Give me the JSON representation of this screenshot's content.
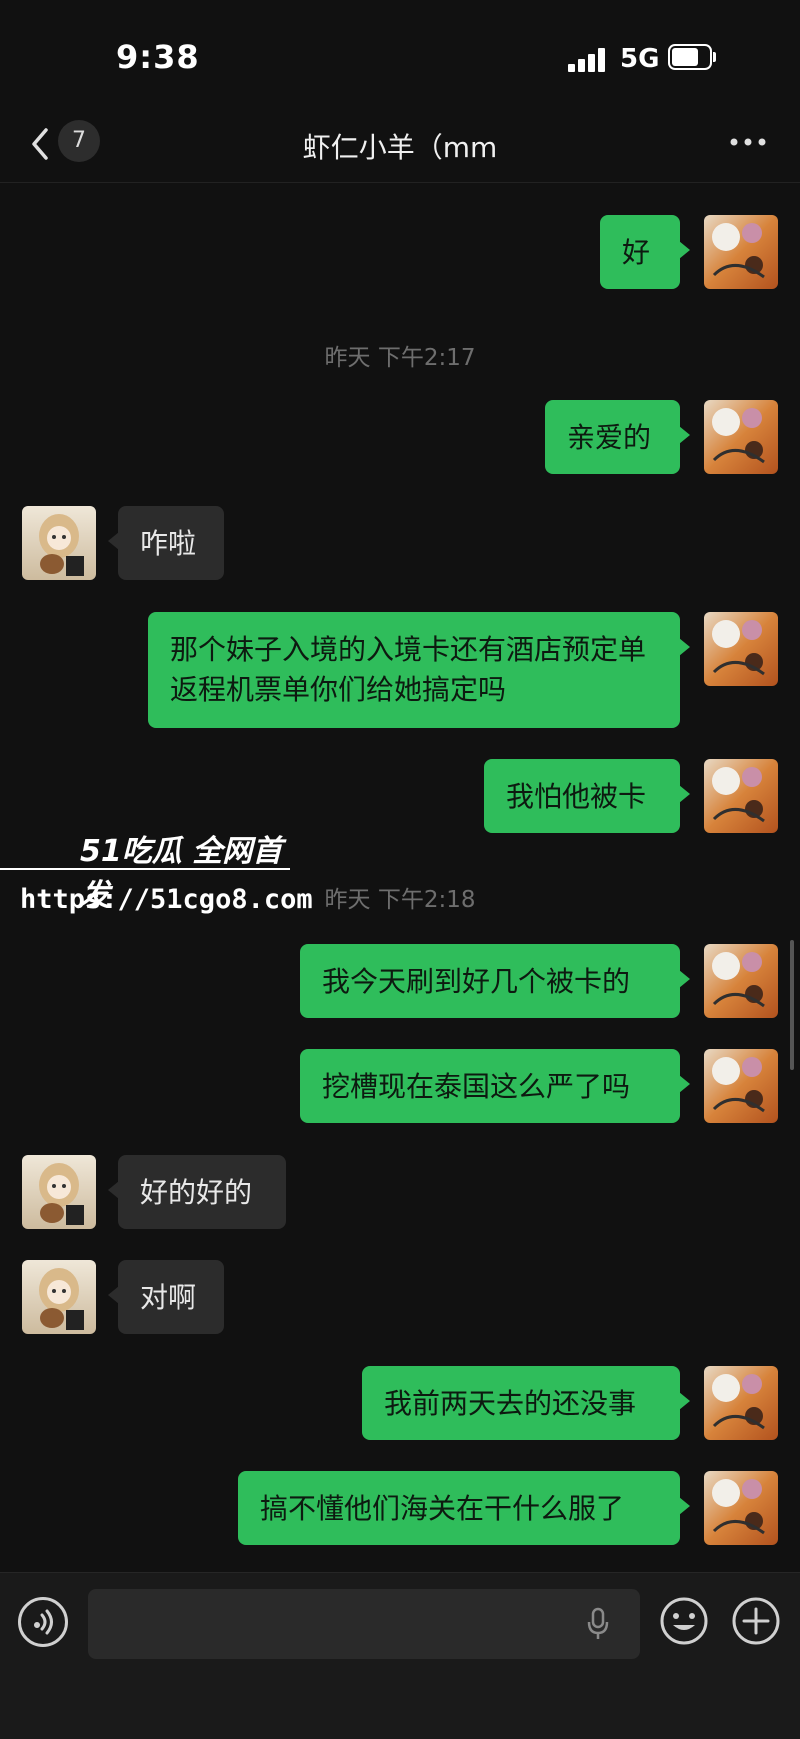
{
  "status": {
    "time": "9:38",
    "network": "5G"
  },
  "header": {
    "unread_count": "7",
    "title": "虾仁小羊（mm"
  },
  "timestamps": [
    "昨天 下午2:17",
    "昨天 下午2:18"
  ],
  "messages": [
    {
      "side": "out",
      "text": "好"
    },
    {
      "side": "out",
      "text": "亲爱的"
    },
    {
      "side": "in",
      "text": "咋啦"
    },
    {
      "side": "out",
      "text": "那个妹子入境的入境卡还有酒店预定单返程机票单你们给她搞定吗"
    },
    {
      "side": "out",
      "text": "我怕他被卡"
    },
    {
      "side": "out",
      "text": "我今天刷到好几个被卡的"
    },
    {
      "side": "out",
      "text": "挖槽现在泰国这么严了吗"
    },
    {
      "side": "in",
      "text": "好的好的"
    },
    {
      "side": "in",
      "text": "对啊"
    },
    {
      "side": "out",
      "text": "我前两天去的还没事"
    },
    {
      "side": "out",
      "text": "搞不懂他们海关在干什么服了"
    }
  ],
  "watermark": {
    "brand": "51吃瓜 全网首发",
    "url": "https://51cgo8.com"
  },
  "colors": {
    "bubble_out": "#2fbd5b",
    "bubble_in": "#2c2c2c",
    "background": "#111111"
  },
  "icons": [
    "chevron-left-icon",
    "more-icon",
    "voice-icon",
    "microphone-icon",
    "emoji-icon",
    "plus-icon"
  ]
}
